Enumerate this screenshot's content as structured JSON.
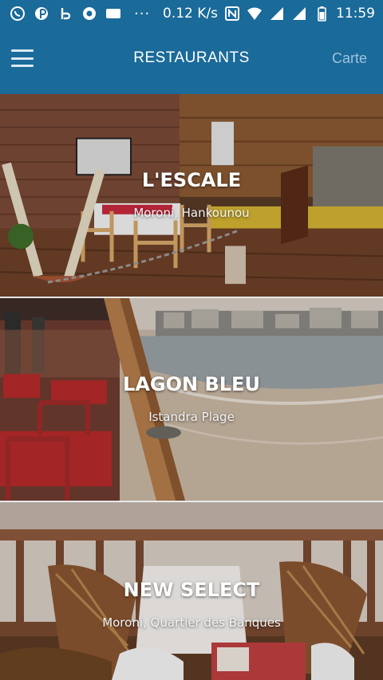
{
  "status_bar": {
    "speed": "0.12 K/s",
    "time": "11:59",
    "dots": "···",
    "gb_label": "GB",
    "n_label": "N"
  },
  "app_bar": {
    "title": "RESTAURANTS",
    "action_label": "Carte",
    "icons": [
      "menu-icon"
    ]
  },
  "restaurants": [
    {
      "name": "L'ESCALE",
      "location": "Moroni, Hankounou"
    },
    {
      "name": "LAGON BLEU",
      "location": "Istandra Plage"
    },
    {
      "name": "NEW SELECT",
      "location": "Moroni, Quartier des Banques"
    }
  ],
  "colors": {
    "primary": "#1a6a9a",
    "action": "#9fc3dd",
    "card_text": "#ffffff"
  }
}
